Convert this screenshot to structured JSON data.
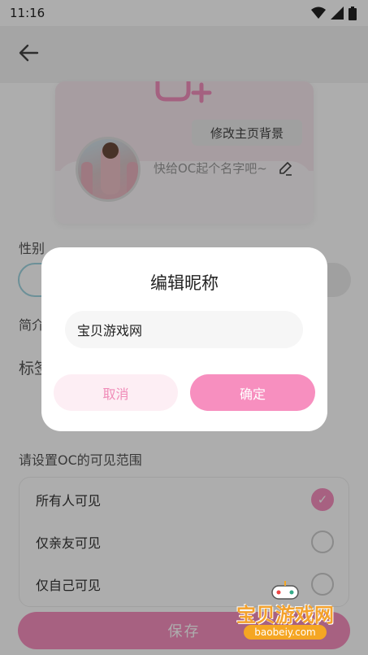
{
  "status_bar": {
    "time": "11:16"
  },
  "profile_card": {
    "change_bg_label": "修改主页背景",
    "nickname_placeholder": "快给OC起个名字吧~"
  },
  "form": {
    "gender_label": "性别",
    "intro_label": "简介",
    "tags_label": "标签",
    "visibility_title": "请设置OC的可见范围",
    "visibility_options": [
      {
        "label": "所有人可见",
        "selected": true
      },
      {
        "label": "仅亲友可见",
        "selected": false
      },
      {
        "label": "仅自己可见",
        "selected": false
      }
    ],
    "save_label": "保存"
  },
  "dialog": {
    "title": "编辑昵称",
    "input_value": "宝贝游戏网",
    "cancel_label": "取消",
    "confirm_label": "确定"
  },
  "watermark": {
    "title": "宝贝游戏网",
    "url": "baobeiy.com"
  },
  "colors": {
    "accent": "#f78fbf",
    "accent_light": "#fdeef4",
    "overlay": "rgba(0,0,0,0.32)"
  }
}
